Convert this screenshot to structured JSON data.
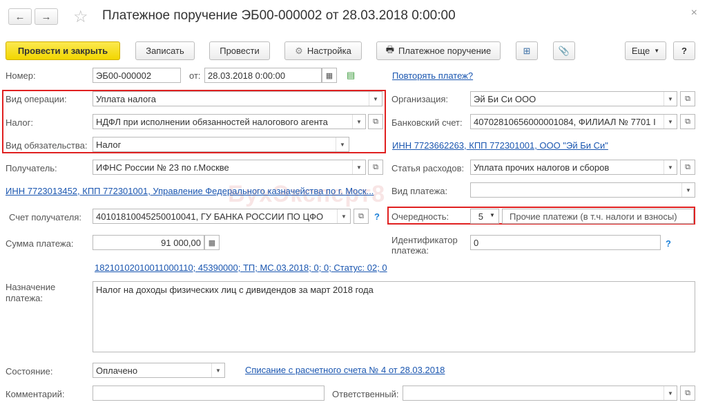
{
  "title": "Платежное поручение ЭБ00-000002 от 28.03.2018 0:00:00",
  "nav": {
    "back": "←",
    "forward": "→",
    "star": "☆",
    "close": "×"
  },
  "toolbar": {
    "post_close": "Провести и закрыть",
    "save": "Записать",
    "post": "Провести",
    "settings": "Настройка",
    "print": "Платежное поручение",
    "more": "Еще",
    "help": "?"
  },
  "form": {
    "number_label": "Номер:",
    "number_value": "ЭБ00-000002",
    "date_label": "от:",
    "date_value": "28.03.2018  0:00:00",
    "repeat_link": "Повторять платеж?",
    "op_type_label": "Вид операции:",
    "op_type_value": "Уплата налога",
    "tax_label": "Налог:",
    "tax_value": "НДФЛ при исполнении обязанностей налогового агента",
    "obligation_label": "Вид обязательства:",
    "obligation_value": "Налог",
    "org_label": "Организация:",
    "org_value": "Эй Би Си ООО",
    "bank_label": "Банковский счет:",
    "bank_value": "40702810656000001084, ФИЛИАЛ № 7701 I",
    "inn_org_link": "ИНН 7723662263, КПП 772301001, ООО \"Эй Би Си\"",
    "recipient_label": "Получатель:",
    "recipient_value": "ИФНС России № 23 по г.Москве",
    "expense_label": "Статья расходов:",
    "expense_value": "Уплата прочих налогов и сборов",
    "inn_recipient_link": "ИНН 7723013452, КПП 772301001, Управление Федерального казначейства по г. Моск...",
    "pay_type_label": "Вид платежа:",
    "pay_type_value": "",
    "recipient_account_label": "Счет получателя:",
    "recipient_account_value": "40101810045250010041, ГУ БАНКА РОССИИ ПО ЦФО",
    "priority_label": "Очередность:",
    "priority_value": "5",
    "priority_desc": "Прочие платежи (в т.ч. налоги и взносы)",
    "amount_label": "Сумма платежа:",
    "amount_value": "91 000,00",
    "identifier_label": "Идентификатор платежа:",
    "identifier_value": "0",
    "budget_link": "18210102010011000110; 45390000; ТП; МС.03.2018; 0; 0; Статус: 02; 0",
    "purpose_label": "Назначение платежа:",
    "purpose_value": "Налог на доходы физических лиц с дивидендов за март 2018 года",
    "status_label": "Состояние:",
    "status_value": "Оплачено",
    "writeoff_link": "Списание с расчетного счета № 4 от 28.03.2018",
    "comment_label": "Комментарий:",
    "comment_value": "",
    "responsible_label": "Ответственный:",
    "responsible_value": ""
  },
  "watermark": "БухЭксперт8",
  "colors": {
    "highlight": "#e02020",
    "link": "#1a56b0",
    "primary": "#f2d600"
  }
}
